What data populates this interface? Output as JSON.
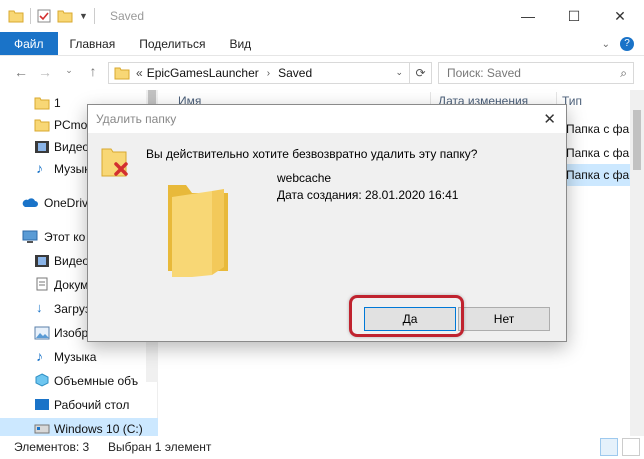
{
  "window": {
    "title": "Saved",
    "controls": {
      "minimize": "—",
      "maximize": "☐",
      "close": "✕"
    }
  },
  "ribbon": {
    "tabs": [
      "Файл",
      "Главная",
      "Поделиться",
      "Вид"
    ]
  },
  "address": {
    "overflow": "«",
    "crumbs": [
      "EpicGamesLauncher",
      "Saved"
    ],
    "search_placeholder": "Поиск: Saved"
  },
  "sidebar": {
    "items": [
      {
        "label": "1",
        "icon": "folder-icon"
      },
      {
        "label": "PCmo",
        "icon": "folder-icon"
      },
      {
        "label": "Видео",
        "icon": "video-icon"
      },
      {
        "label": "Музыка",
        "icon": "music-icon"
      },
      {
        "label": "OneDrive",
        "icon": "cloud-icon"
      },
      {
        "label": "Этот ко",
        "icon": "computer-icon"
      },
      {
        "label": "Видео",
        "icon": "video-icon"
      },
      {
        "label": "Докум",
        "icon": "document-icon"
      },
      {
        "label": "Загруз",
        "icon": "download-icon"
      },
      {
        "label": "Изобр",
        "icon": "image-icon"
      },
      {
        "label": "Музыка",
        "icon": "music-icon"
      },
      {
        "label": "Объемные объ",
        "icon": "3d-objects-icon"
      },
      {
        "label": "Рабочий стол",
        "icon": "desktop-icon"
      },
      {
        "label": "Windows 10 (C:)",
        "icon": "drive-icon"
      }
    ]
  },
  "filelist": {
    "columns": [
      "Имя",
      "Дата изменения",
      "Тип"
    ],
    "types": [
      "Папка с файлам",
      "Папка с файлам",
      "Папка с файлам"
    ]
  },
  "status": {
    "count": "Элементов: 3",
    "selected": "Выбран 1 элемент"
  },
  "dialog": {
    "title": "Удалить папку",
    "question": "Вы действительно хотите безвозвратно удалить эту папку?",
    "name": "webcache",
    "created": "Дата создания: 28.01.2020 16:41",
    "yes": "Да",
    "no": "Нет"
  },
  "colors": {
    "file_tab": "#1a73c8",
    "selection": "#cce8ff",
    "highlight": "#c0232f",
    "folder": "#f8d775"
  }
}
